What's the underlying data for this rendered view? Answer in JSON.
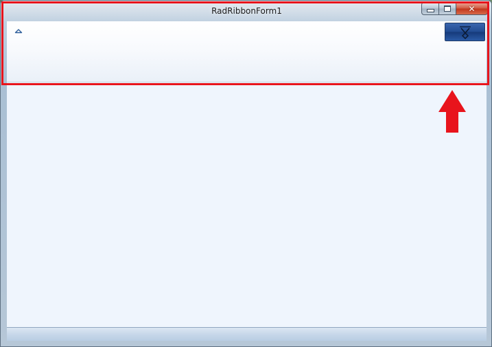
{
  "window": {
    "title": "RadRibbonForm1",
    "caption_buttons": {
      "minimize_icon": "minimize-icon",
      "maximize_icon": "maximize-icon",
      "close_icon": "close-icon",
      "close_glyph": "✕"
    }
  },
  "ribbon": {
    "expand_toggle_icon": "collapse-ribbon-chevron-icon",
    "app_menu_icon": "application-menu-icon"
  },
  "annotation": {
    "highlight_color": "#e8141c",
    "arrow_direction": "up"
  },
  "colors": {
    "app_button": "#214b92",
    "client_background": "#eff5fd",
    "close_button": "#c2351b"
  }
}
